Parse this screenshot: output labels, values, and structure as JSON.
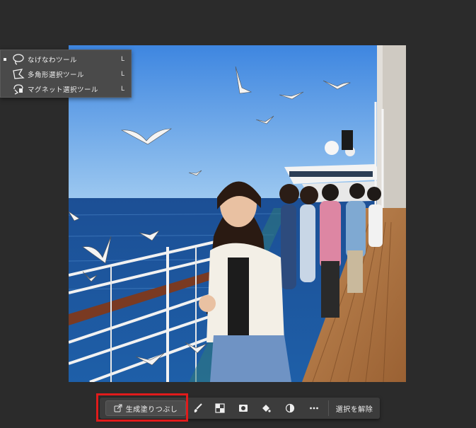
{
  "tool_flyout": {
    "items": [
      {
        "label": "なげなわツール",
        "shortcut": "L",
        "icon": "lasso-icon",
        "selected": true
      },
      {
        "label": "多角形選択ツール",
        "shortcut": "L",
        "icon": "polygonal-lasso-icon",
        "selected": false
      },
      {
        "label": "マグネット選択ツール",
        "shortcut": "L",
        "icon": "magnetic-lasso-icon",
        "selected": false
      }
    ]
  },
  "task_bar": {
    "generative_fill_label": "生成塗りつぶし",
    "deselect_label": "選択を解除",
    "icons": [
      "brush-icon",
      "mask-icon",
      "selection-mask-icon",
      "fill-icon",
      "adjustment-icon",
      "more-icon"
    ]
  },
  "colors": {
    "highlight": "#e01b1b",
    "panel": "#4a4a4a",
    "taskbar": "#3c3c3c",
    "workspace": "#2b2b2b"
  }
}
